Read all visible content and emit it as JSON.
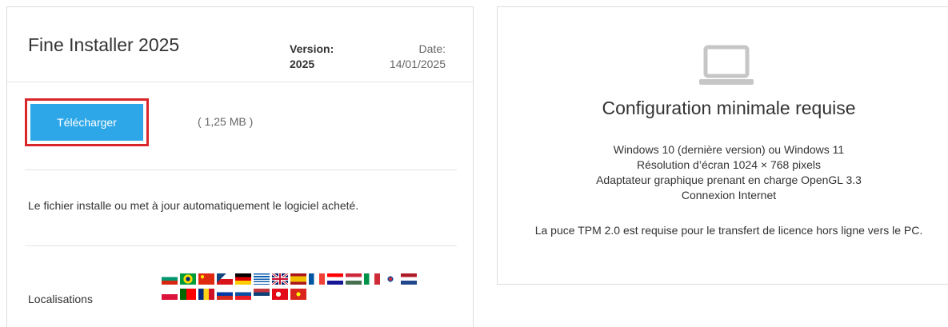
{
  "product": {
    "title": "Fine Installer 2025",
    "version_label": "Version:",
    "version_value": "2025",
    "date_label": "Date:",
    "date_value": "14/01/2025"
  },
  "download": {
    "button_label": "Télécharger",
    "size": "( 1,25 MB )",
    "highlight_color": "#d9262b",
    "button_color": "#2da7e8"
  },
  "description": "Le fichier installe ou met à jour automatiquement le logiciel acheté.",
  "localisations": {
    "label": "Localisations",
    "flags_row1": [
      "bulgaria-flag",
      "brazil-flag",
      "china-flag",
      "czech-flag",
      "germany-flag",
      "greece-flag",
      "uk-flag",
      "spain-flag",
      "france-flag",
      "croatia-flag",
      "hungary-flag",
      "italy-flag",
      "korea-flag",
      "netherlands-flag"
    ],
    "flags_row2": [
      "poland-flag",
      "portugal-flag",
      "romania-flag",
      "russia-flag",
      "slovakia-flag",
      "serbia-flag",
      "turkey-flag",
      "vietnam-flag"
    ]
  },
  "requirements": {
    "icon": "laptop-icon",
    "title": "Configuration minimale requise",
    "items": [
      "Windows 10 (dernière version) ou Windows 11",
      "Résolution d’écran 1024 × 768 pixels",
      "Adaptateur graphique prenant en charge OpenGL 3.3",
      "Connexion Internet"
    ],
    "note": "La puce TPM 2.0 est requise pour le transfert de licence hors ligne vers le PC."
  }
}
